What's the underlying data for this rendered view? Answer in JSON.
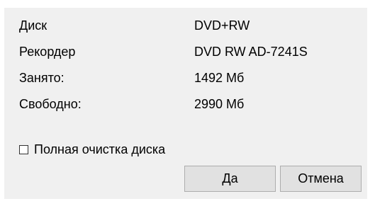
{
  "info": [
    {
      "label": "Диск",
      "value": "DVD+RW"
    },
    {
      "label": "Рекордер",
      "value": "DVD RW AD-7241S"
    },
    {
      "label": "Занято:",
      "value": "1492 Мб"
    },
    {
      "label": "Свободно:",
      "value": "2990 Мб"
    }
  ],
  "full_erase": {
    "label": "Полная очистка диска",
    "checked": false
  },
  "buttons": {
    "ok_label": "Да",
    "cancel_label": "Отмена"
  }
}
